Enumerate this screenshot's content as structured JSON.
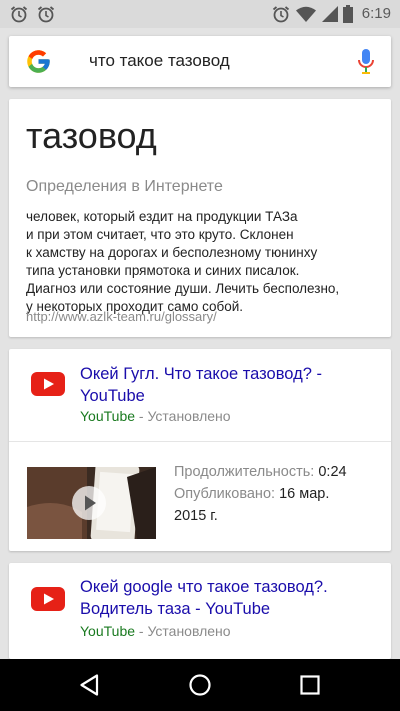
{
  "status_bar": {
    "time": "6:19",
    "icons": [
      "alarm-icon",
      "alarm-icon",
      "alarm-icon",
      "wifi-icon",
      "signal-icon",
      "battery-icon"
    ]
  },
  "search": {
    "query": "что такое тазовод",
    "logo": "google-g-icon",
    "mic_icon": "microphone-icon"
  },
  "definition": {
    "term": "тазовод",
    "source_label": "Определения в Интернете",
    "line1": "человек, который ездит на продукции ТАЗа",
    "line2": "и при этом считает, что это круто. Склонен",
    "line3": "к хамству на дорогах и бесполезному тюнинху",
    "line4": "типа установки прямотока и синих писалок.",
    "line5": "Диагноз или состояние души. Лечить бесполезно,",
    "line6": "у некоторых проходит само собой.",
    "url": "http://www.azlk-team.ru/glossary/"
  },
  "results": [
    {
      "title_line1": "Окей Гугл. Что такое тазовод? -",
      "title_line2": "YouTube",
      "site": "YouTube",
      "status": " - Установлено",
      "duration_label": "Продолжительность:",
      "duration": "0:24",
      "published_label": "Опубликовано:",
      "published_line1": "16 мар.",
      "published_line2": "2015 г."
    },
    {
      "title_line1": "Окей google что такое тазовод?.",
      "title_line2": "Водитель таза - YouTube",
      "site": "YouTube",
      "status": " - Установлено"
    }
  ],
  "colors": {
    "link": "#1a0dab",
    "site_green": "#1a7a20",
    "youtube_red": "#e62117",
    "gray_text": "#8a8a8a"
  },
  "nav": {
    "icons": [
      "back-icon",
      "home-icon",
      "recents-icon"
    ]
  }
}
